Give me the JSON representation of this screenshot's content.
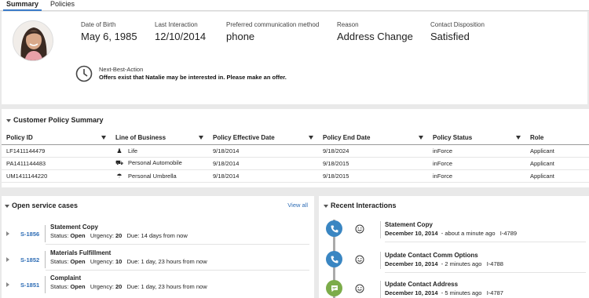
{
  "tabs": [
    {
      "label": "Summary",
      "active": true
    },
    {
      "label": "Policies",
      "active": false
    }
  ],
  "customer": {
    "fields": [
      {
        "label": "Date of Birth",
        "value": "May 6, 1985"
      },
      {
        "label": "Last Interaction",
        "value": "12/10/2014"
      },
      {
        "label": "Preferred communication method",
        "value": "phone"
      },
      {
        "label": "Reason",
        "value": "Address Change"
      },
      {
        "label": "Contact Disposition",
        "value": "Satisfied"
      }
    ],
    "nba": {
      "title": "Next-Best-Action",
      "message": "Offers exist that Natalie may be interested in. Please make an offer."
    }
  },
  "policy_summary": {
    "title": "Customer Policy Summary",
    "columns": [
      "Policy ID",
      "Line of Business",
      "Policy Effective Date",
      "Policy End Date",
      "Policy Status",
      "Role"
    ],
    "rows": [
      {
        "id": "LF1411144479",
        "lob": "Life",
        "lob_icon": "person-icon",
        "effective": "9/18/2014",
        "end": "9/18/2024",
        "status": "inForce",
        "role": "Applicant"
      },
      {
        "id": "PA1411144483",
        "lob": "Personal Automobile",
        "lob_icon": "car-icon",
        "effective": "9/18/2014",
        "end": "9/18/2015",
        "status": "inForce",
        "role": "Applicant"
      },
      {
        "id": "UM1411144220",
        "lob": "Personal Umbrella",
        "lob_icon": "umbrella-icon",
        "effective": "9/18/2014",
        "end": "9/18/2015",
        "status": "inForce",
        "role": "Applicant"
      }
    ]
  },
  "open_cases": {
    "title": "Open service cases",
    "view_all": "View all",
    "status_label": "Status:",
    "urgency_label": "Urgency:",
    "due_label": "Due:",
    "items": [
      {
        "id": "S-1856",
        "title": "Statement Copy",
        "status": "Open",
        "urgency": "20",
        "due": "14 days from now"
      },
      {
        "id": "S-1852",
        "title": "Materials Fulfillment",
        "status": "Open",
        "urgency": "10",
        "due": "1 day, 23 hours from now"
      },
      {
        "id": "S-1851",
        "title": "Complaint",
        "status": "Open",
        "urgency": "20",
        "due": "1 day, 23 hours from now"
      }
    ]
  },
  "recent_interactions": {
    "title": "Recent Interactions",
    "items": [
      {
        "title": "Statement Copy",
        "date": "December 10, 2014",
        "ago": "- about a minute ago",
        "ref": "I-4789",
        "channel_icon": "phone-icon",
        "color": "#3a86c2"
      },
      {
        "title": "Update Contact Comm Options",
        "date": "December 10, 2014",
        "ago": "- 2 minutes ago",
        "ref": "I-4788",
        "channel_icon": "phone-icon",
        "color": "#3a86c2"
      },
      {
        "title": "Update Contact Address",
        "date": "December 10, 2014",
        "ago": "- 5 minutes ago",
        "ref": "I-4787",
        "channel_icon": "chat-icon",
        "color": "#7cac4a"
      }
    ]
  },
  "colors": {
    "link": "#2d6cb5",
    "phone": "#3a86c2",
    "chat": "#7cac4a"
  }
}
